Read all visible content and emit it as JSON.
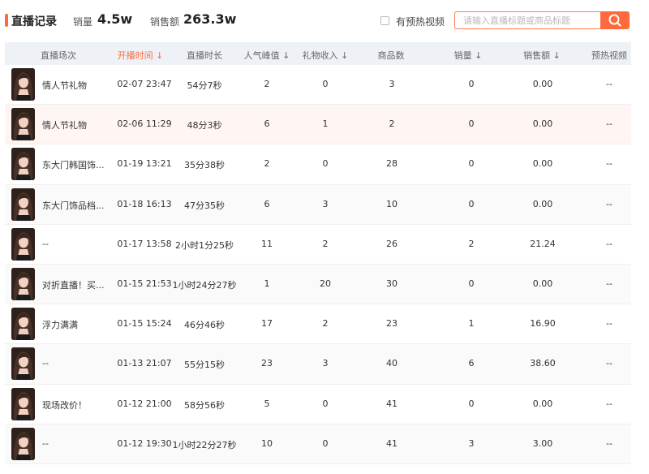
{
  "header": {
    "title": "直播记录",
    "sales_label": "销量",
    "sales_value": "4.5w",
    "revenue_label": "销售额",
    "revenue_value": "263.3w",
    "preheat_label": "有预热视频",
    "search_placeholder": "请输入直播标题或商品标题"
  },
  "colors": {
    "accent": "#ff6a3c",
    "header_bg": "#eef1f6",
    "highlight_row": "#fff5f2"
  },
  "table": {
    "columns": [
      {
        "label": "直播场次"
      },
      {
        "label": "开播时间 ↓",
        "active": true
      },
      {
        "label": "直播时长"
      },
      {
        "label": "人气峰值 ↓"
      },
      {
        "label": "礼物收入 ↓"
      },
      {
        "label": "商品数"
      },
      {
        "label": "销量 ↓"
      },
      {
        "label": "销售额 ↓"
      },
      {
        "label": "预热视频"
      }
    ],
    "rows": [
      {
        "title": "情人节礼物",
        "start": "02-07 23:47",
        "duration": "54分7秒",
        "peak": "2",
        "gift": "0",
        "goods": "3",
        "sales": "0",
        "revenue": "0.00",
        "preheat": "--"
      },
      {
        "title": "情人节礼物",
        "start": "02-06 11:29",
        "duration": "48分3秒",
        "peak": "6",
        "gift": "1",
        "goods": "2",
        "sales": "0",
        "revenue": "0.00",
        "preheat": "--"
      },
      {
        "title": "东大门韩国饰...",
        "start": "01-19 13:21",
        "duration": "35分38秒",
        "peak": "2",
        "gift": "0",
        "goods": "28",
        "sales": "0",
        "revenue": "0.00",
        "preheat": "--"
      },
      {
        "title": "东大门饰品档...",
        "start": "01-18 16:13",
        "duration": "47分35秒",
        "peak": "6",
        "gift": "3",
        "goods": "10",
        "sales": "0",
        "revenue": "0.00",
        "preheat": "--"
      },
      {
        "title": "--",
        "start": "01-17 13:58",
        "duration": "2小时1分25秒",
        "peak": "11",
        "gift": "2",
        "goods": "26",
        "sales": "2",
        "revenue": "21.24",
        "preheat": "--"
      },
      {
        "title": "对折直播！买...",
        "start": "01-15 21:53",
        "duration": "1小时24分27秒",
        "peak": "1",
        "gift": "20",
        "goods": "30",
        "sales": "0",
        "revenue": "0.00",
        "preheat": "--"
      },
      {
        "title": "浮力满满",
        "start": "01-15 15:24",
        "duration": "46分46秒",
        "peak": "17",
        "gift": "2",
        "goods": "23",
        "sales": "1",
        "revenue": "16.90",
        "preheat": "--"
      },
      {
        "title": "--",
        "start": "01-13 21:07",
        "duration": "55分15秒",
        "peak": "23",
        "gift": "3",
        "goods": "40",
        "sales": "6",
        "revenue": "38.60",
        "preheat": "--"
      },
      {
        "title": "现场改价！",
        "start": "01-12 21:00",
        "duration": "58分56秒",
        "peak": "5",
        "gift": "0",
        "goods": "41",
        "sales": "0",
        "revenue": "0.00",
        "preheat": "--"
      },
      {
        "title": "--",
        "start": "01-12 19:30",
        "duration": "1小时22分27秒",
        "peak": "10",
        "gift": "0",
        "goods": "41",
        "sales": "3",
        "revenue": "3.00",
        "preheat": "--"
      }
    ]
  }
}
